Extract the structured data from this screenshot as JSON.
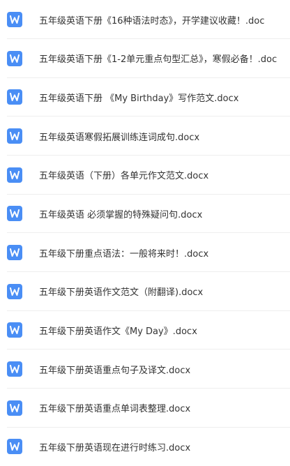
{
  "files": [
    {
      "name": "五年级英语下册《16种语法时态》，开学建议收藏！.doc",
      "icon": "word-document-icon"
    },
    {
      "name": "五年级英语下册《1-2单元重点句型汇总》，寒假必备！.doc",
      "icon": "word-document-icon"
    },
    {
      "name": "五年级英语下册 《My Birthday》写作范文.docx",
      "icon": "word-document-icon"
    },
    {
      "name": "五年级英语寒假拓展训练连词成句.docx",
      "icon": "word-document-icon"
    },
    {
      "name": "五年级英语（下册）各单元作文范文.docx",
      "icon": "word-document-icon"
    },
    {
      "name": "五年级英语 必须掌握的特殊疑问句.docx",
      "icon": "word-document-icon"
    },
    {
      "name": "五年级下册重点语法：一般将来时！.docx",
      "icon": "word-document-icon"
    },
    {
      "name": "五年级下册英语作文范文（附翻译).docx",
      "icon": "word-document-icon"
    },
    {
      "name": "五年级下册英语作文《My Day》.docx",
      "icon": "word-document-icon"
    },
    {
      "name": "五年级下册英语重点句子及译文.docx",
      "icon": "word-document-icon"
    },
    {
      "name": "五年级下册英语重点单词表整理.docx",
      "icon": "word-document-icon"
    },
    {
      "name": "五年级下册英语现在进行时练习.docx",
      "icon": "word-document-icon"
    }
  ],
  "colors": {
    "word_icon": "#4a8ef5",
    "text": "#333333",
    "divider": "#eeeeee"
  }
}
